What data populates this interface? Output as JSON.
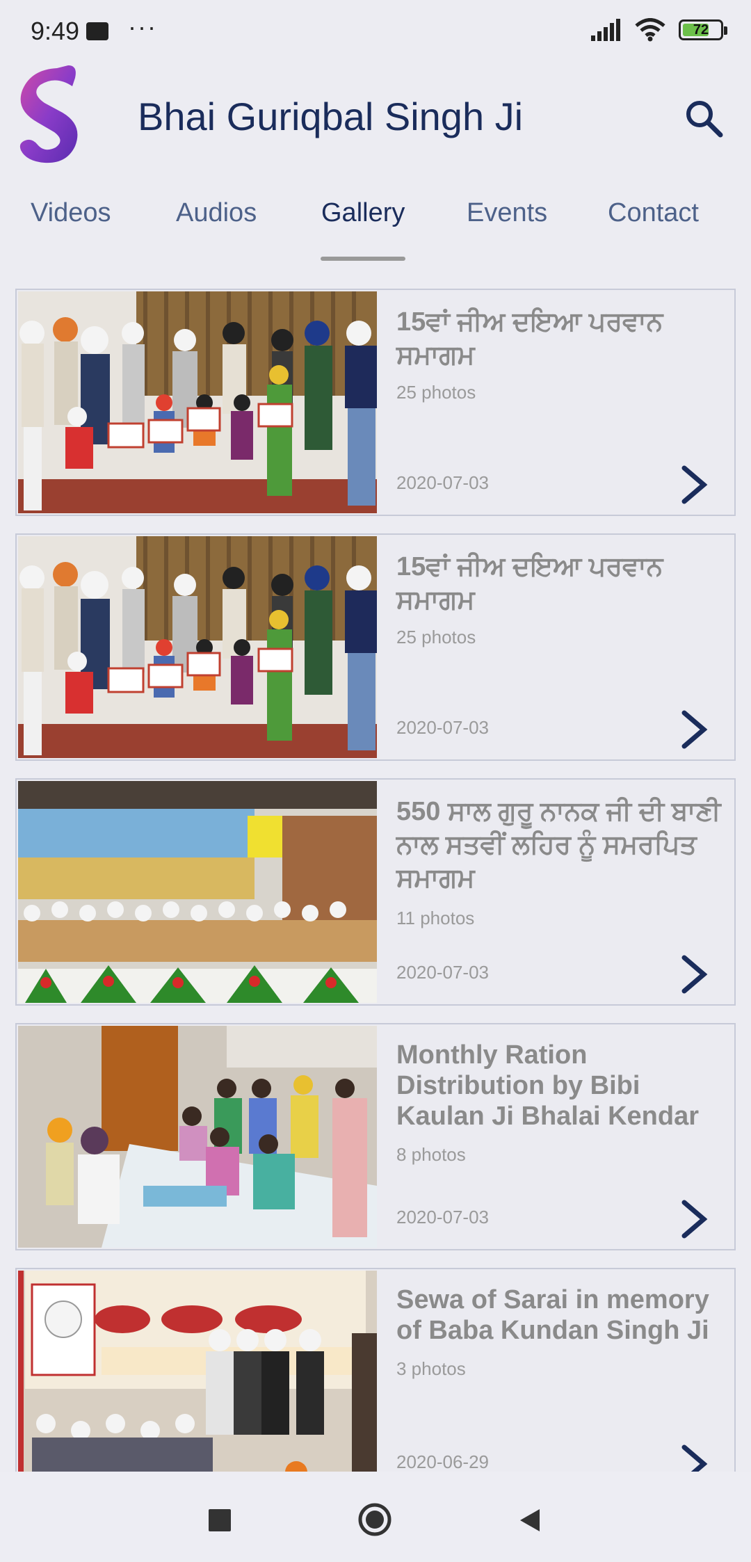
{
  "status_bar": {
    "time": "9:49",
    "dots": "···",
    "battery": "72",
    "battery_level": 0.72,
    "battery_color": "#6cc04a"
  },
  "header": {
    "title": "Bhai Guriqbal Singh Ji",
    "logo_icon": "app-logo-s",
    "search_icon": "search-icon",
    "title_color": "#1a2c5b"
  },
  "tabs": [
    {
      "label": "Videos",
      "active": false
    },
    {
      "label": "Audios",
      "active": false
    },
    {
      "label": "Gallery",
      "active": true
    },
    {
      "label": "Events",
      "active": false
    },
    {
      "label": "Contact",
      "active": false
    }
  ],
  "albums": [
    {
      "title": "15ਵਾਂ ਜੀਅ ਦਇਆ ਪਰਵਾਨ ਸਮਾਗਮ",
      "count": "25 photos",
      "date": "2020-07-03",
      "thumb": "group-photo-certificates"
    },
    {
      "title": "15ਵਾਂ ਜੀਅ ਦਇਆ ਪਰਵਾਨ ਸਮਾਗਮ",
      "count": "25 photos",
      "date": "2020-07-03",
      "thumb": "group-photo-certificates"
    },
    {
      "title": "550 ਸਾਲ ਗੁਰੂ ਨਾਨਕ ਜੀ ਦੀ ਬਾਣੀ ਨਾਲ ਸਤਵੀਂ ਲਹਿਰ ਨੂੰ ਸਮਰਪਿਤ ਸਮਾਗਮ",
      "count": "11 photos",
      "date": "2020-07-03",
      "thumb": "kirtan-stage"
    },
    {
      "title": "Monthly Ration Distribution by Bibi Kaulan Ji Bhalai Kendar",
      "count": "8 photos",
      "date": "2020-07-03",
      "thumb": "ration-distribution"
    },
    {
      "title": "Sewa of Sarai in memory of Baba Kundan Singh Ji",
      "count": "3 photos",
      "date": "2020-06-29",
      "thumb": "sewa-event-banner"
    }
  ],
  "nav_bar": {
    "recents_icon": "square-icon",
    "home_icon": "circle-icon",
    "back_icon": "triangle-back-icon"
  }
}
